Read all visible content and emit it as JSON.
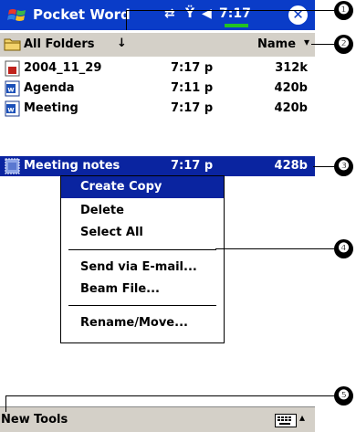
{
  "titlebar": {
    "app_title": "Pocket Word",
    "clock": "7:17",
    "close_symbol": "✕"
  },
  "folderbar": {
    "folder_label": "All Folders",
    "folder_arrow": "↓",
    "sort_label": "Name",
    "sort_arrow": "▾"
  },
  "files": [
    {
      "name": "2004_11_29",
      "time": "7:17 p",
      "size": "312k",
      "icon": "ink-note-icon"
    },
    {
      "name": "Agenda",
      "time": "7:11 p",
      "size": "420b",
      "icon": "word-doc-icon"
    },
    {
      "name": "Meeting",
      "time": "7:17 p",
      "size": "420b",
      "icon": "word-doc-icon"
    },
    {
      "name": "Meeting notes",
      "time": "7:17 p",
      "size": "428b",
      "icon": "template-doc-icon",
      "selected": true
    }
  ],
  "context_menu": {
    "items": [
      {
        "label": "Create Copy",
        "highlighted": true
      },
      {
        "label": "Delete"
      },
      {
        "label": "Select All"
      },
      {
        "label": "Send via E-mail..."
      },
      {
        "label": "Beam File..."
      },
      {
        "label": "Rename/Move..."
      }
    ]
  },
  "bottombar": {
    "new_label": "New",
    "tools_label": "Tools",
    "sip_arrow": "▴"
  },
  "callouts": [
    "❶",
    "❷",
    "❸",
    "❹",
    "❺"
  ],
  "colors": {
    "title_blue": "#0a3cc8",
    "selection_blue": "#0a24a0",
    "bar_gray": "#d4d0c8"
  }
}
